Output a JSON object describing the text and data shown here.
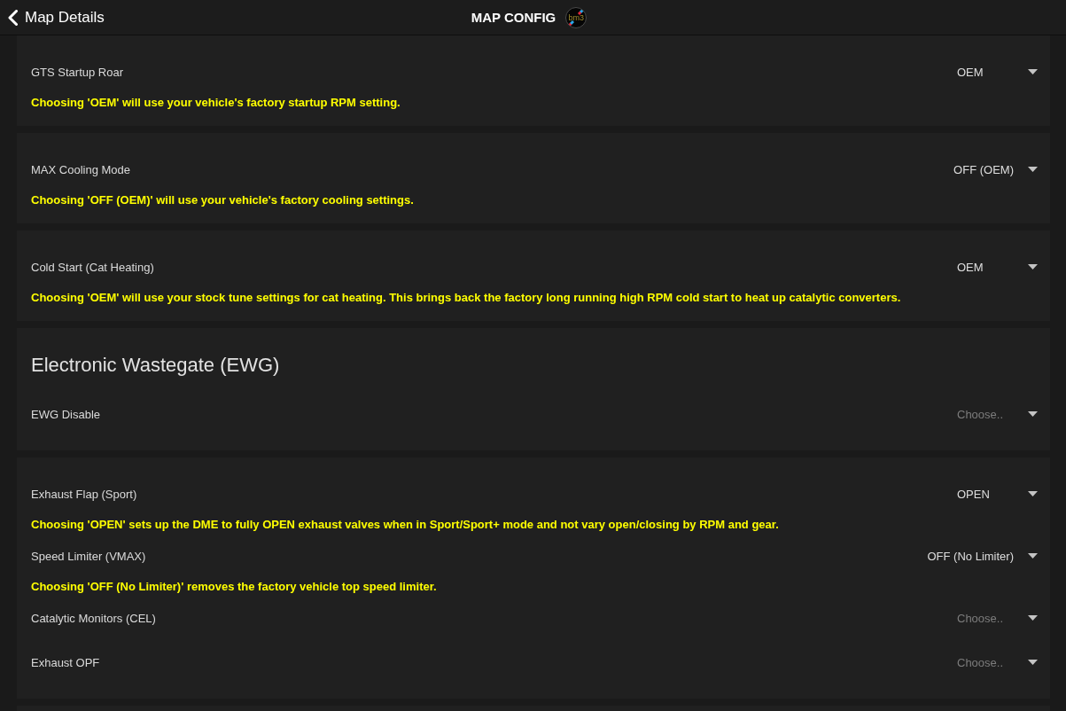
{
  "header": {
    "back_label": "Map Details",
    "title": "MAP CONFIG",
    "logo_text": "bm3"
  },
  "sections": [
    {
      "settings": [
        {
          "label": "GTS Startup Roar",
          "value": "OEM",
          "note": "Choosing 'OEM' will use your vehicle's factory startup RPM setting."
        }
      ]
    },
    {
      "settings": [
        {
          "label": "MAX Cooling Mode",
          "value": "OFF (OEM)",
          "note": "Choosing 'OFF (OEM)' will use your vehicle's factory cooling settings."
        }
      ]
    },
    {
      "settings": [
        {
          "label": "Cold Start (Cat Heating)",
          "value": "OEM",
          "note": "Choosing 'OEM' will use your stock tune settings for cat heating. This brings back the factory long running high RPM cold start to heat up catalytic converters."
        }
      ]
    },
    {
      "heading": "Electronic Wastegate (EWG)",
      "settings": [
        {
          "label": "EWG Disable",
          "placeholder": "Choose.."
        }
      ]
    },
    {
      "settings": [
        {
          "label": "Exhaust Flap (Sport)",
          "value": "OPEN",
          "note": "Choosing 'OPEN' sets up the DME to fully OPEN exhaust valves when in Sport/Sport+ mode and not vary open/closing by RPM and gear."
        },
        {
          "label": "Speed Limiter (VMAX)",
          "value": "OFF (No Limiter)",
          "note": "Choosing 'OFF (No Limiter)' removes the factory vehicle top speed limiter."
        },
        {
          "label": "Catalytic Monitors (CEL)",
          "placeholder": "Choose.."
        },
        {
          "label": "Exhaust OPF",
          "placeholder": "Choose.."
        }
      ]
    }
  ]
}
